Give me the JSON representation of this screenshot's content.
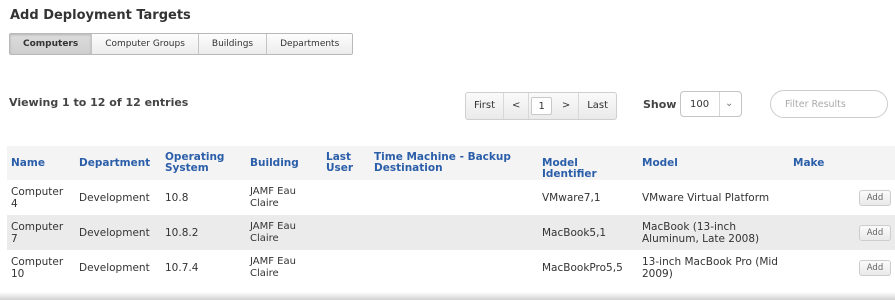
{
  "page": {
    "title": "Add Deployment Targets"
  },
  "tabs": [
    {
      "label": "Computers",
      "active": true
    },
    {
      "label": "Computer Groups",
      "active": false
    },
    {
      "label": "Buildings",
      "active": false
    },
    {
      "label": "Departments",
      "active": false
    }
  ],
  "viewing_text": "Viewing 1 to 12 of 12 entries",
  "pagination": {
    "first": "First",
    "prev": "<",
    "current": "1",
    "next": ">",
    "last": "Last"
  },
  "show": {
    "label": "Show",
    "value": "100"
  },
  "filter": {
    "placeholder": "Filter Results"
  },
  "table": {
    "headers": {
      "name": "Name",
      "department": "Department",
      "os": "Operating System",
      "building": "Building",
      "last_user": "Last User",
      "tm": "Time Machine - Backup Destination",
      "model_id": "Model Identifier",
      "model": "Model",
      "make": "Make"
    },
    "rows": [
      {
        "name": "Computer 4",
        "department": "Development",
        "os": "10.8",
        "building": "JAMF Eau Claire",
        "last_user": "",
        "tm": "",
        "model_id": "VMware7,1",
        "model": "VMware Virtual Platform",
        "make": "",
        "action": "Add"
      },
      {
        "name": "Computer 7",
        "department": "Development",
        "os": "10.8.2",
        "building": "JAMF Eau Claire",
        "last_user": "",
        "tm": "",
        "model_id": "MacBook5,1",
        "model": "MacBook (13-inch Aluminum, Late 2008)",
        "make": "",
        "action": "Add"
      },
      {
        "name": "Computer 10",
        "department": "Development",
        "os": "10.7.4",
        "building": "JAMF Eau Claire",
        "last_user": "",
        "tm": "",
        "model_id": "MacBookPro5,5",
        "model": "13-inch MacBook Pro (Mid 2009)",
        "make": "",
        "action": "Add"
      }
    ]
  }
}
